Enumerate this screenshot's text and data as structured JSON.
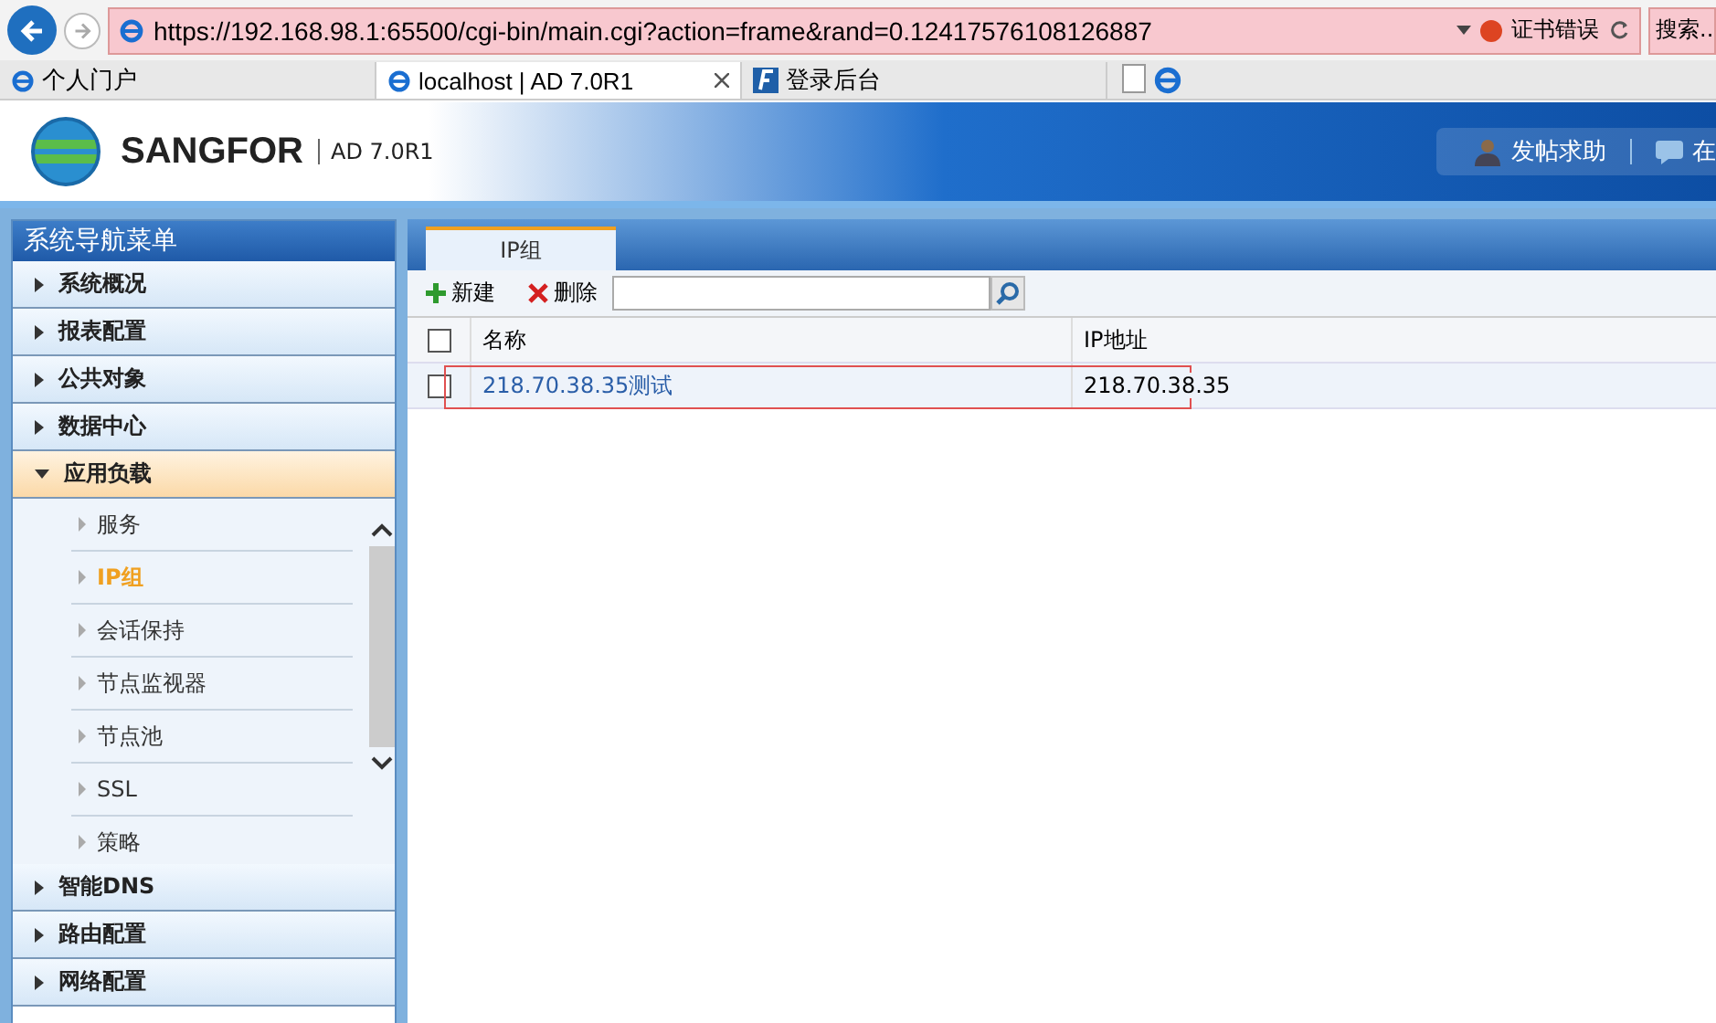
{
  "browser": {
    "url": "https://192.168.98.1:65500/cgi-bin/main.cgi?action=frame&rand=0.12417576108126887",
    "cert_error": "证书错误",
    "search": "搜索...",
    "tabs": [
      {
        "label": "个人门户",
        "selected": false
      },
      {
        "label": "localhost | AD 7.0R1",
        "selected": true
      },
      {
        "label": "登录后台",
        "selected": false
      }
    ]
  },
  "header": {
    "brand": "SANGFOR",
    "version": "AD 7.0R1",
    "links": [
      "发帖求助",
      "在"
    ]
  },
  "sidebar": {
    "title": "系统导航菜单",
    "items": [
      {
        "label": "系统概况",
        "expanded": false
      },
      {
        "label": "报表配置",
        "expanded": false
      },
      {
        "label": "公共对象",
        "expanded": false
      },
      {
        "label": "数据中心",
        "expanded": false
      },
      {
        "label": "应用负载",
        "expanded": true,
        "children": [
          {
            "label": "服务",
            "selected": false
          },
          {
            "label": "IP组",
            "selected": true
          },
          {
            "label": "会话保持",
            "selected": false
          },
          {
            "label": "节点监视器",
            "selected": false
          },
          {
            "label": "节点池",
            "selected": false
          },
          {
            "label": "SSL",
            "selected": false
          },
          {
            "label": "策略",
            "selected": false
          }
        ]
      },
      {
        "label": "智能DNS",
        "expanded": false
      },
      {
        "label": "路由配置",
        "expanded": false
      },
      {
        "label": "网络配置",
        "expanded": false
      }
    ]
  },
  "main": {
    "tabs": [
      {
        "label": "IP组",
        "selected": true
      }
    ],
    "toolbar": {
      "new": "新建",
      "delete": "删除"
    },
    "table": {
      "columns": [
        "名称",
        "IP地址"
      ],
      "all_checked": false,
      "rows": [
        {
          "name": "218.70.38.35测试",
          "ip": "218.70.38.35",
          "checked": false,
          "highlighted": true
        }
      ]
    }
  }
}
